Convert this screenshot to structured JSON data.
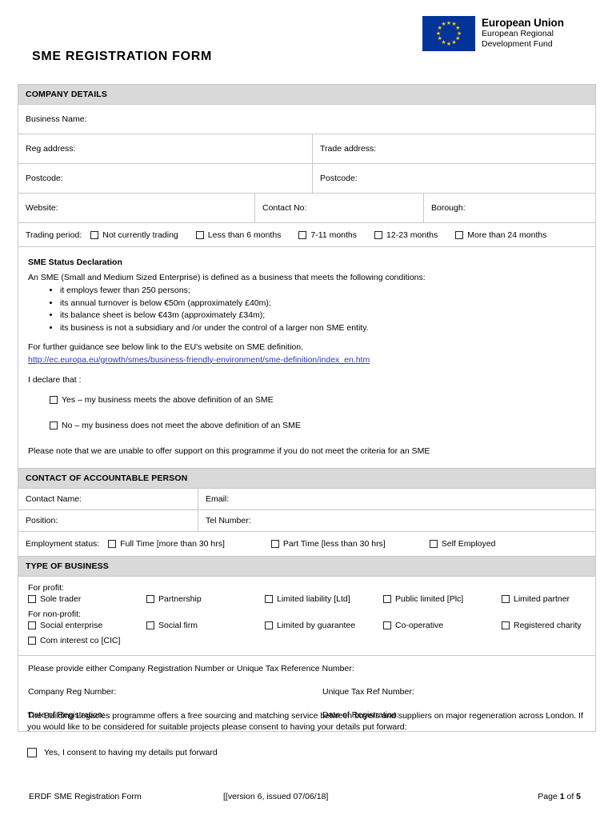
{
  "header": {
    "form_title": "SME REGISTRATION FORM",
    "eu_logo": {
      "title": "European Union",
      "line1": "European Regional",
      "line2": "Development Fund",
      "flag_color": "#023399",
      "star_color": "#ffcc00",
      "star_count": 12
    }
  },
  "company_details": {
    "section_title": "COMPANY DETAILS",
    "business_name_label": "Business Name:",
    "reg_address_label": "Reg address:",
    "trade_address_label": "Trade address:",
    "postcode_label_left": "Postcode:",
    "postcode_label_right": "Postcode:",
    "website_label": "Website:",
    "contact_no_label": "Contact No:",
    "borough_label": "Borough:",
    "trading_period_label": "Trading period:",
    "trading_period_options": [
      "Not currently trading",
      "Less than 6 months",
      "7-11 months",
      "12-23 months",
      "More than 24 months"
    ]
  },
  "sme_declaration": {
    "heading": "SME Status Declaration",
    "intro": "An SME (Small and Medium Sized Enterprise) is defined as a business that meets the following conditions:",
    "conditions": [
      "it employs fewer than 250 persons;",
      "its annual turnover is below €50m (approximately £40m);",
      "its balance sheet is below €43m (approximately £34m);",
      "its business is not a subsidiary and /or under the control of a larger non SME entity."
    ],
    "guidance": "For further guidance see below link to the EU's website on SME definition.",
    "link": "http://ec.europa.eu/growth/smes/business-friendly-environment/sme-definition/index_en.htm",
    "declare_label": "I declare that :",
    "yes_option": "Yes – my business meets the above definition of an SME",
    "no_option": "No – my business does not meet the above definition of an SME",
    "note": "Please note that we are unable to offer support on this programme if you do not meet the criteria for an SME"
  },
  "contact_person": {
    "section_title": "CONTACT OF ACCOUNTABLE PERSON",
    "contact_name_label": "Contact Name:",
    "email_label": "Email:",
    "position_label": "Position:",
    "tel_number_label": "Tel Number:",
    "employment_status_label": "Employment status:",
    "employment_options": [
      "Full Time [more than 30 hrs]",
      "Part Time [less than 30 hrs]",
      "Self Employed"
    ]
  },
  "type_of_business": {
    "section_title": "TYPE OF BUSINESS",
    "for_profit_label": "For profit:",
    "for_profit_options": [
      "Sole trader",
      "Partnership",
      "Limited liability [Ltd]",
      "Public limited [Plc]",
      "Limited partner"
    ],
    "for_non_profit_label": "For non-profit:",
    "for_non_profit_options": [
      "Social enterprise",
      "Social firm",
      "Limited by guarantee",
      "Co-operative",
      "Registered charity"
    ],
    "cic_option": "Com interest co [CIC]",
    "provide_either": "Please provide either Company Registration Number or Unique Tax Reference Number:",
    "company_reg_number_label": "Company Reg Number:",
    "unique_tax_ref_label": "Unique Tax Ref Number:",
    "date_of_registration_left": "Date of Registration:",
    "date_of_registration_right": "Date of Registration:"
  },
  "consent": {
    "paragraph": "The Building Legacies programme offers a free sourcing and matching service between buyers and suppliers on major regeneration across London.  If you would like to be considered for suitable projects please consent to having your details put forward:",
    "option": "Yes, I consent to having my details put forward"
  },
  "footer": {
    "left": "ERDF SME Registration Form",
    "center": "[[version 6, issued 07/06/18]",
    "page_prefix": "Page ",
    "page_current": "1",
    "page_mid": " of ",
    "page_total": "5"
  }
}
